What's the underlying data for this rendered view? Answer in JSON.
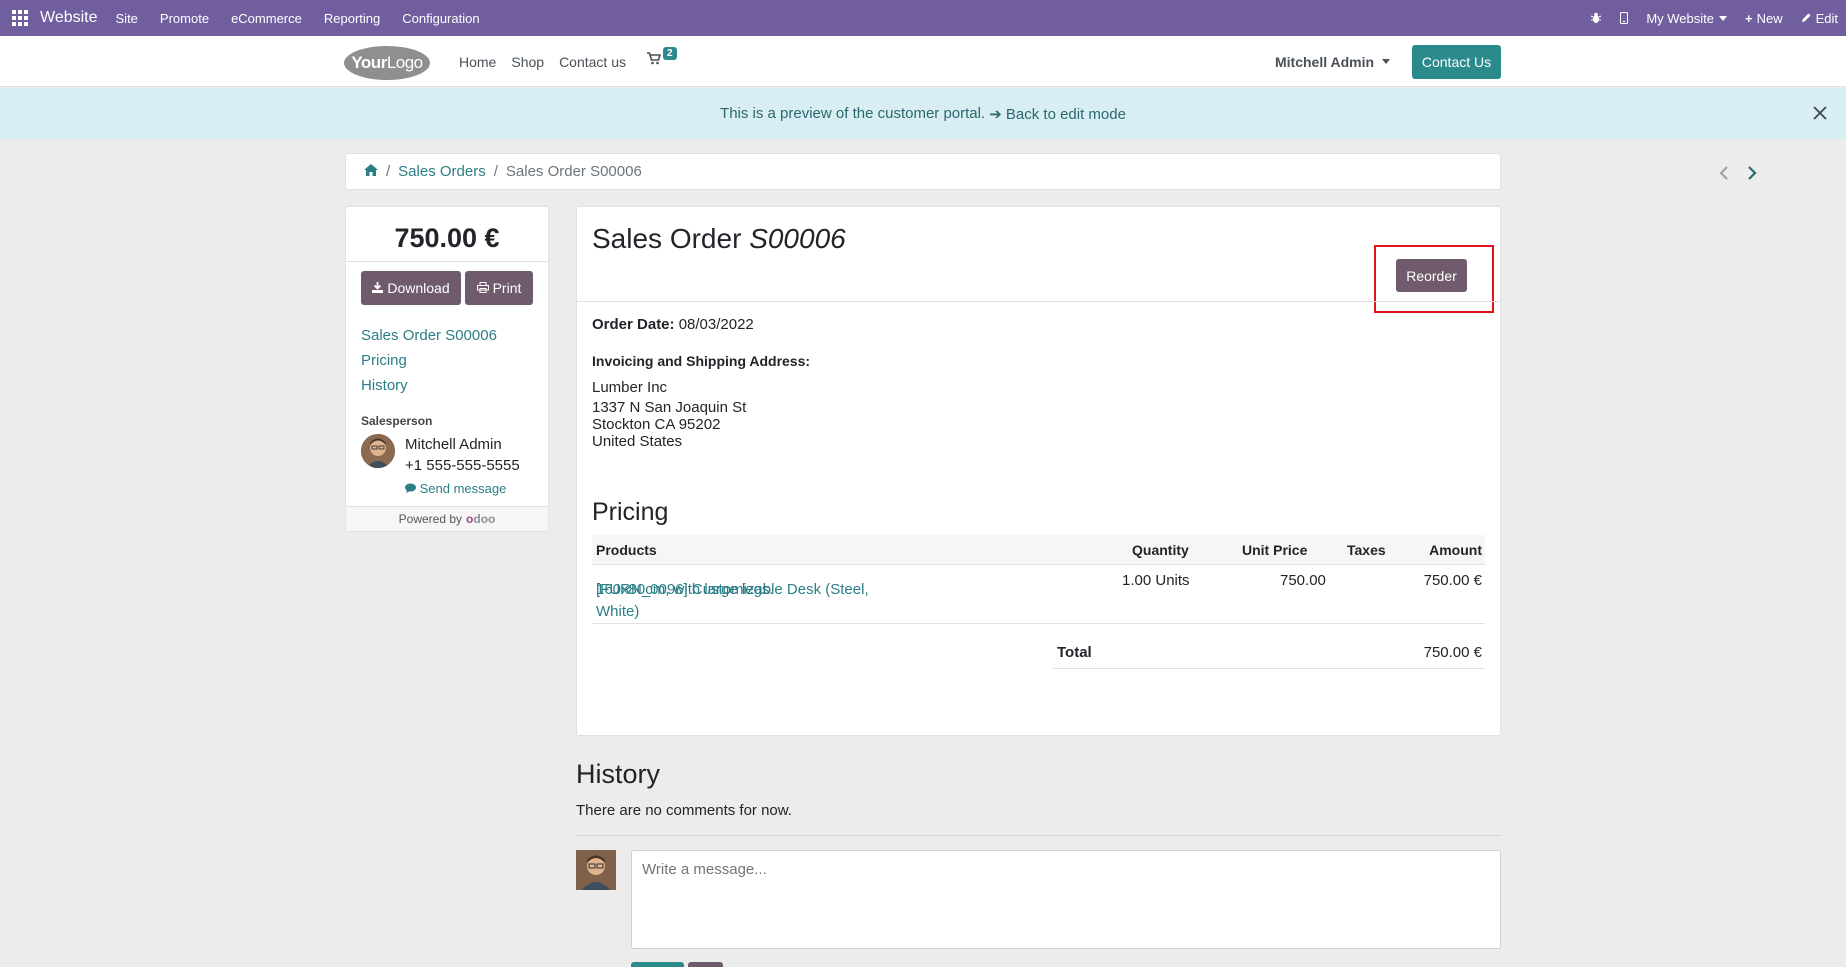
{
  "topbar": {
    "brand": "Website",
    "menu": [
      "Site",
      "Promote",
      "eCommerce",
      "Reporting",
      "Configuration"
    ],
    "website_selector": "My Website",
    "new_label": "New",
    "edit_label": "Edit"
  },
  "navbar": {
    "logo_bold": "Your",
    "logo_rest": "Logo",
    "links": [
      "Home",
      "Shop",
      "Contact us"
    ],
    "cart_count": "2",
    "user_name": "Mitchell Admin",
    "contact_button": "Contact Us"
  },
  "alert": {
    "text": "This is a preview of the customer portal.",
    "back_link": "Back to edit mode"
  },
  "breadcrumb": {
    "sales_orders": "Sales Orders",
    "current": "Sales Order S00006"
  },
  "sidebar": {
    "amount": "750.00 €",
    "download_label": "Download",
    "print_label": "Print",
    "nav": [
      "Sales Order S00006",
      "Pricing",
      "History"
    ],
    "salesperson_label": "Salesperson",
    "salesperson_name": "Mitchell Admin",
    "salesperson_phone": "+1 555-555-5555",
    "send_message": "Send message",
    "powered_by": "Powered by",
    "odoo_o": "o",
    "odoo_rest": "doo"
  },
  "order": {
    "title_prefix": "Sales Order",
    "title_number": "S00006",
    "reorder_label": "Reorder",
    "order_date_label": "Order Date:",
    "order_date": "08/03/2022",
    "address_label": "Invoicing and Shipping Address:",
    "address": [
      "Lumber Inc",
      "1337 N San Joaquin St",
      "Stockton CA 95202",
      "United States"
    ],
    "pricing_title": "Pricing",
    "columns": {
      "products": "Products",
      "quantity": "Quantity",
      "unit_price": "Unit Price",
      "taxes": "Taxes",
      "amount": "Amount"
    },
    "line": {
      "product_line1": "[FURN_0096] Customizable Desk (Steel, White)",
      "product_line2": "160x80cm, with large legs.",
      "quantity": "1.00 Units",
      "unit_price": "750.00",
      "taxes": "",
      "amount": "750.00 €"
    },
    "total_label": "Total",
    "total_amount": "750.00 €"
  },
  "history": {
    "title": "History",
    "empty_text": "There are no comments for now.",
    "message_placeholder": "Write a message..."
  },
  "colors": {
    "admin_bar": "#715e9e",
    "primary": "#2b8a8c",
    "secondary": "#6f5b6b",
    "alert_bg": "#d9eef2",
    "highlight_box": "#e0121c"
  }
}
